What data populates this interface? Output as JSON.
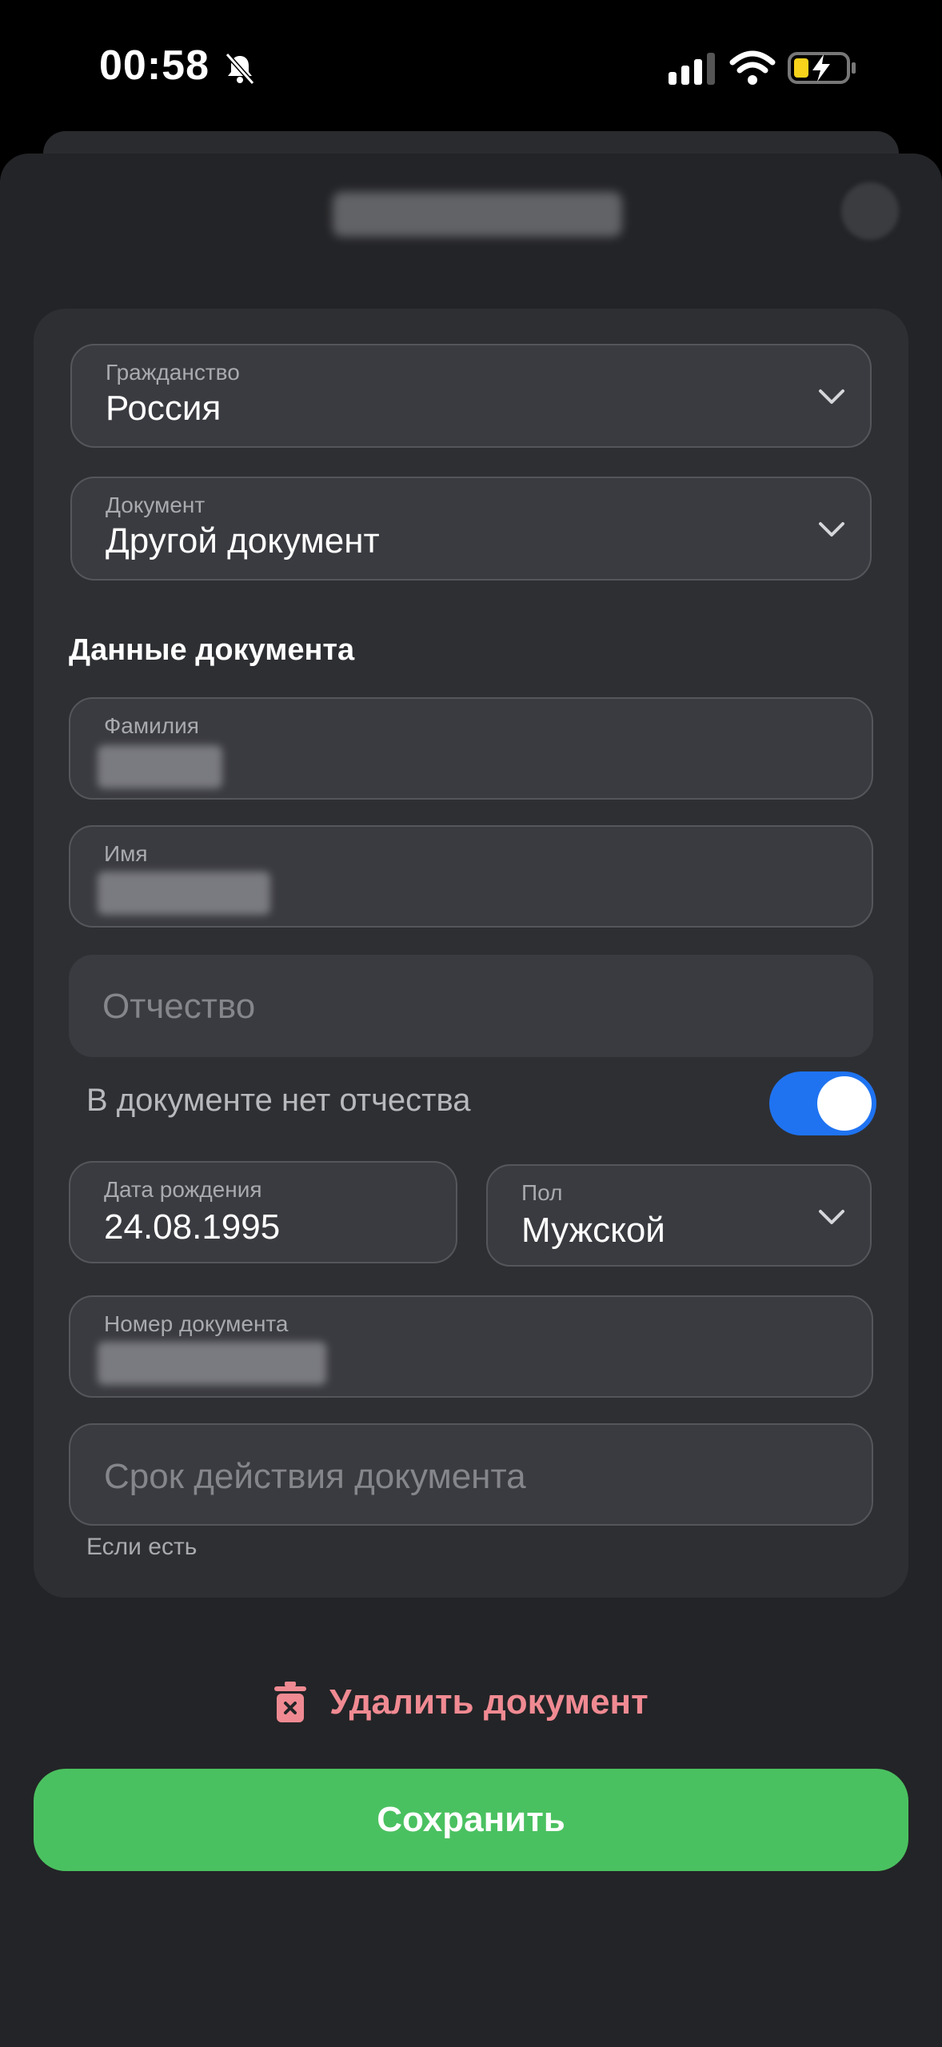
{
  "status_bar": {
    "time": "00:58"
  },
  "form": {
    "citizenship": {
      "label": "Гражданство",
      "value": "Россия"
    },
    "document_type": {
      "label": "Документ",
      "value": "Другой документ"
    },
    "section_title": "Данные документа",
    "last_name": {
      "label": "Фамилия"
    },
    "first_name": {
      "label": "Имя"
    },
    "patronymic": {
      "placeholder": "Отчество"
    },
    "no_patronymic": {
      "label": "В документе нет отчества",
      "enabled": true
    },
    "birth_date": {
      "label": "Дата рождения",
      "value": "24.08.1995"
    },
    "gender": {
      "label": "Пол",
      "value": "Мужской"
    },
    "document_number": {
      "label": "Номер документа"
    },
    "expiry": {
      "placeholder": "Срок действия документа",
      "hint": "Если есть"
    }
  },
  "actions": {
    "delete_label": "Удалить документ",
    "save_label": "Сохранить"
  },
  "colors": {
    "accent_blue": "#1f73f1",
    "save_green": "#4ac160",
    "delete_pink": "#f08a92",
    "sheet_bg": "#232427",
    "card_bg": "#2e2f33",
    "field_bg": "#3a3b40"
  }
}
